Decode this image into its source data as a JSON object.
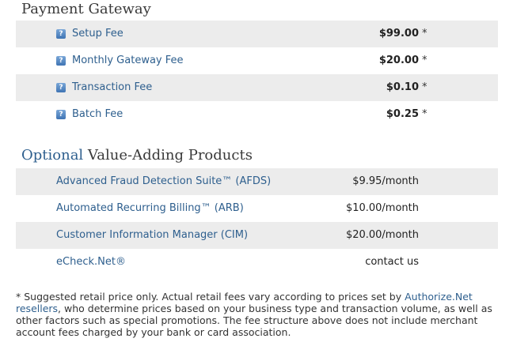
{
  "payment_gateway": {
    "title": "Payment Gateway",
    "fees": [
      {
        "label": "Setup Fee",
        "price": "$99.00",
        "mark": "*"
      },
      {
        "label": "Monthly Gateway Fee",
        "price": "$20.00",
        "mark": "*"
      },
      {
        "label": "Transaction Fee",
        "price": "$0.10",
        "mark": "*"
      },
      {
        "label": "Batch Fee",
        "price": "$0.25",
        "mark": "*"
      }
    ],
    "help_icon_glyph": "?"
  },
  "products": {
    "title_accent": "Optional",
    "title_rest": " Value-Adding Products",
    "items": [
      {
        "label": "Advanced Fraud Detection Suite™ (AFDS)",
        "price": "$9.95/month"
      },
      {
        "label": "Automated Recurring Billing™ (ARB)",
        "price": "$10.00/month"
      },
      {
        "label": "Customer Information Manager (CIM)",
        "price": "$20.00/month"
      },
      {
        "label": "eCheck.Net®",
        "price": "contact us"
      }
    ]
  },
  "footnote": {
    "text_before": "* Suggested retail price only. Actual retail fees vary according to prices set by ",
    "link1": "Authorize.Net",
    "space": " ",
    "link2": "resellers",
    "text_after": ", who determine prices based on your business type and transaction volume, as well as other factors such as special promotions. The fee structure above does not include merchant account fees charged by your bank or card association."
  },
  "colors": {
    "accent": "#2e5f8e",
    "row_shade": "#ececec",
    "icon": "#3f74b3"
  }
}
